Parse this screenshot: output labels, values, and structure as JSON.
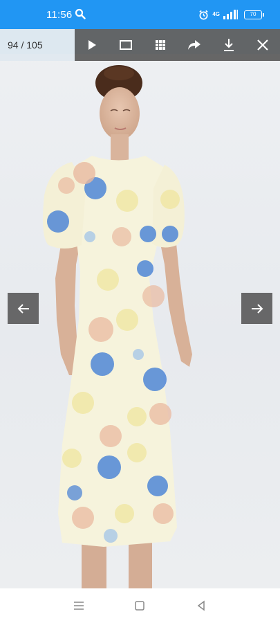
{
  "status_bar": {
    "time": "11:56",
    "network": "4G",
    "battery": "70",
    "color": "#2196f3"
  },
  "viewer": {
    "counter": "94 / 105",
    "tools": [
      {
        "icon": "play-icon"
      },
      {
        "icon": "fullscreen-icon"
      },
      {
        "icon": "grid-icon"
      },
      {
        "icon": "share-icon"
      },
      {
        "icon": "download-icon"
      },
      {
        "icon": "close-icon"
      }
    ],
    "toolbar_color": "#4e4e4e"
  },
  "arrows": {
    "prev_icon": "arrow-left-icon",
    "next_icon": "arrow-right-icon"
  },
  "photo": {
    "subject": "model-floral-dress",
    "dress_base_color": "#f6f3dc",
    "flower_colors": [
      "#4f86d6",
      "#e9b9a0",
      "#efe49a",
      "#9cc0e8"
    ]
  },
  "system_nav": {
    "buttons": [
      "menu-icon",
      "home-icon",
      "back-icon"
    ]
  }
}
